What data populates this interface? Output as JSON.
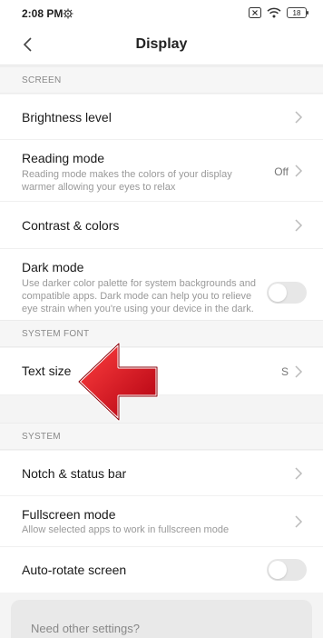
{
  "status_bar": {
    "time": "2:08 PM",
    "battery": "18"
  },
  "header": {
    "title": "Display"
  },
  "sections": {
    "screen": "SCREEN",
    "system_font": "SYSTEM FONT",
    "system": "SYSTEM"
  },
  "rows": {
    "brightness": {
      "title": "Brightness level"
    },
    "reading": {
      "title": "Reading mode",
      "subtitle": "Reading mode makes the colors of your display warmer allowing your eyes to relax",
      "value": "Off"
    },
    "contrast": {
      "title": "Contrast & colors"
    },
    "dark": {
      "title": "Dark mode",
      "subtitle": "Use darker color palette for system backgrounds and compatible apps. Dark mode can help you to relieve eye strain when you're using your device in the dark."
    },
    "text_size": {
      "title": "Text size",
      "value": "S"
    },
    "notch": {
      "title": "Notch & status bar"
    },
    "fullscreen": {
      "title": "Fullscreen mode",
      "subtitle": "Allow selected apps to work in fullscreen mode"
    },
    "autorotate": {
      "title": "Auto-rotate screen"
    }
  },
  "footer": {
    "more_settings": "Need other settings?"
  },
  "colors": {
    "arrow": "#d0101a",
    "toggle_off": "#e7e7e7"
  },
  "icons": [
    "settings-gear-icon",
    "close-box-icon",
    "wifi-icon",
    "battery-icon",
    "back-arrow-icon",
    "chevron-right-icon",
    "red-pointer-arrow"
  ]
}
